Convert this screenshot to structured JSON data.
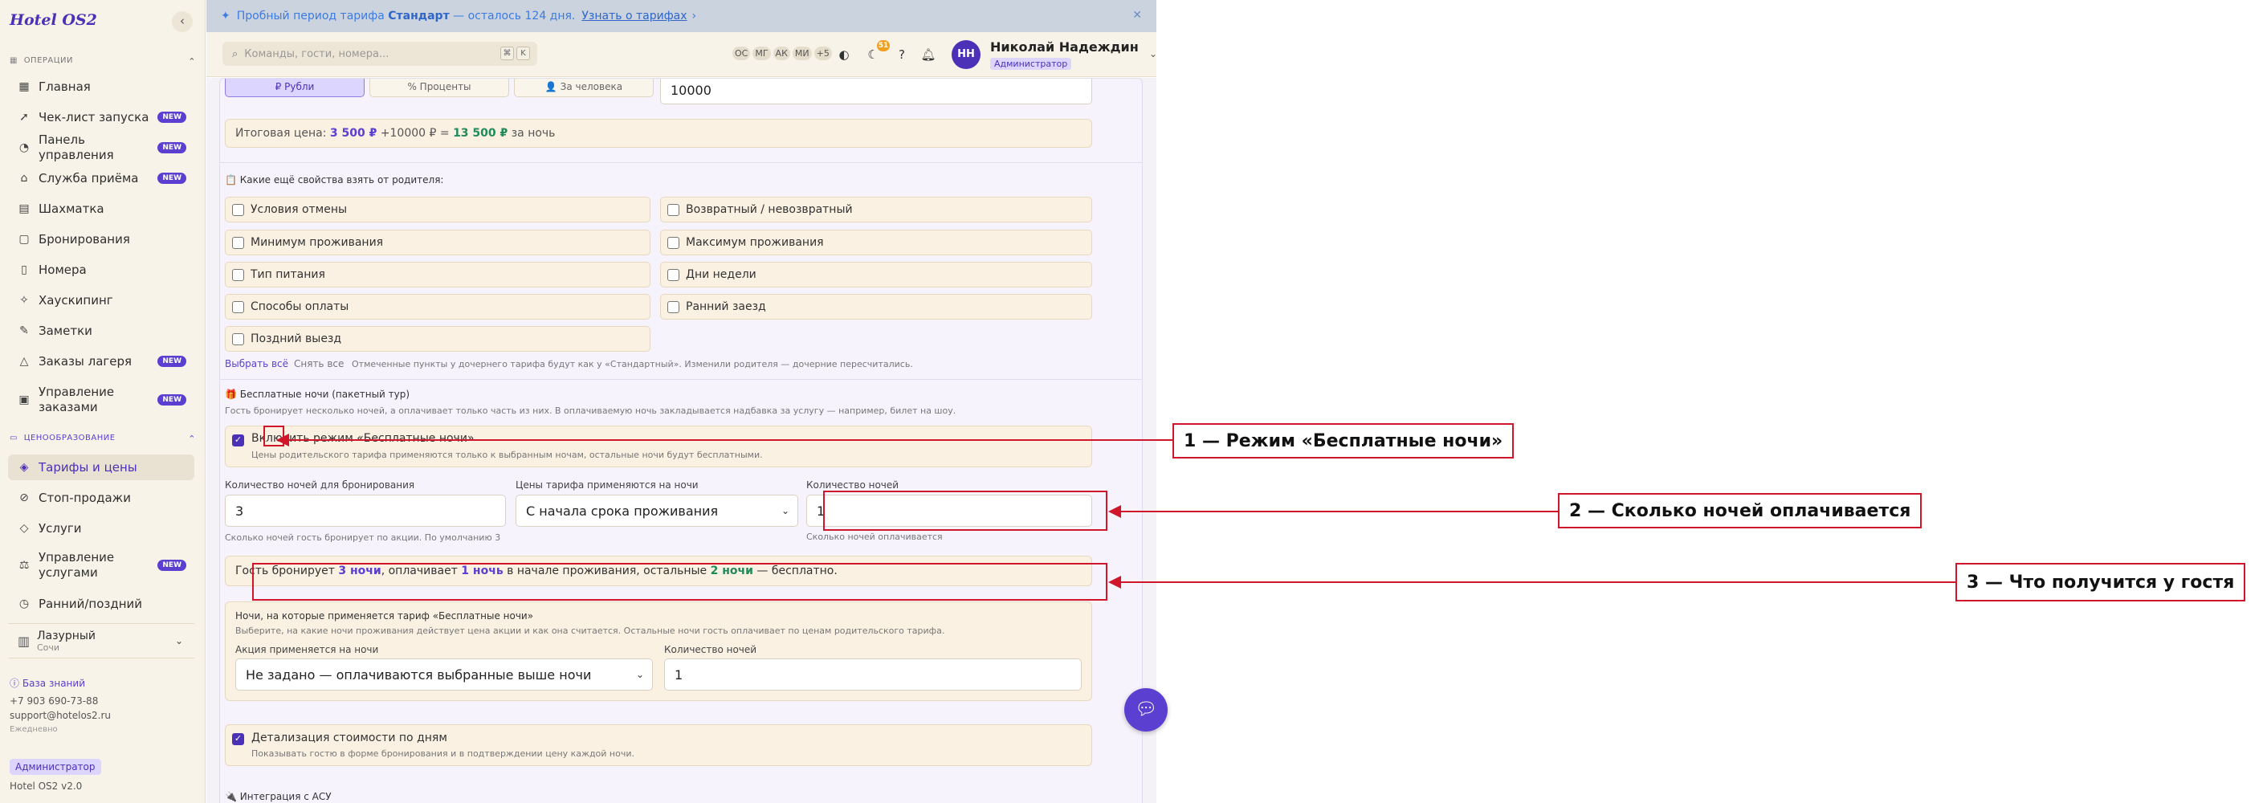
{
  "app": {
    "logo": "Hotel OS2",
    "collapse_icon": "‹"
  },
  "sidebar": {
    "sections": [
      {
        "label": "ОПЕРАЦИИ"
      },
      {
        "label": "ЦЕНООБРАЗОВАНИЕ"
      }
    ],
    "items": [
      {
        "label": "Главная",
        "icon": "grid-icon",
        "glyph": "▦",
        "new": ""
      },
      {
        "label": "Чек-лист запуска",
        "icon": "rocket-icon",
        "glyph": "➚",
        "new": "NEW"
      },
      {
        "label": "Панель управления",
        "icon": "gauge-icon",
        "glyph": "◔",
        "new": "NEW"
      },
      {
        "label": "Служба приёма",
        "icon": "bell-icon",
        "glyph": "⌂",
        "new": "NEW"
      },
      {
        "label": "Шахматка",
        "icon": "table-icon",
        "glyph": "▤",
        "new": ""
      },
      {
        "label": "Бронирования",
        "icon": "calendar-icon",
        "glyph": "▢",
        "new": ""
      },
      {
        "label": "Номера",
        "icon": "door-icon",
        "glyph": "▯",
        "new": ""
      },
      {
        "label": "Хаускипинг",
        "icon": "sparkle-icon",
        "glyph": "✧",
        "new": ""
      },
      {
        "label": "Заметки",
        "icon": "note-icon",
        "glyph": "✎",
        "new": ""
      },
      {
        "label": "Заказы лагеря",
        "icon": "tent-icon",
        "glyph": "△",
        "new": "NEW"
      },
      {
        "label": "Управление заказами",
        "icon": "clipboard-icon",
        "glyph": "▣",
        "new": "NEW"
      },
      {
        "label": "Тарифы и цены",
        "icon": "tag-icon",
        "glyph": "◈",
        "new": ""
      },
      {
        "label": "Стоп-продажи",
        "icon": "ban-icon",
        "glyph": "⊘",
        "new": ""
      },
      {
        "label": "Услуги",
        "icon": "tag-icon",
        "glyph": "◇",
        "new": ""
      },
      {
        "label": "Управление услугами",
        "icon": "service-icon",
        "glyph": "⚖",
        "new": "NEW"
      },
      {
        "label": "Ранний/поздний",
        "icon": "clock-icon",
        "glyph": "◷",
        "new": ""
      }
    ],
    "hotel": {
      "name": "Лазурный",
      "city": "Сочи"
    },
    "kb_link": "База знаний",
    "phone": "+7 903 690-73-88",
    "email": "support@hotelos2.ru",
    "schedule": "Ежедневно",
    "role": "Администратор",
    "version": "Hotel OS2 v2.0"
  },
  "trial": {
    "prefix": "Пробный период тарифа",
    "plan": "Стандарт",
    "suffix": "— осталось 124 дня.",
    "link": "Узнать о тарифах",
    "link_arrow": "›",
    "close": "✕"
  },
  "topbar": {
    "search_placeholder": "Команды, гости, номера...",
    "kbd1": "⌘",
    "kbd2": "K",
    "presence": [
      "ОС",
      "МГ",
      "АК",
      "МИ",
      "+5"
    ],
    "notif_count": "51",
    "user_initials": "НН",
    "user_name": "Николай Надеждин",
    "user_role": "Администратор"
  },
  "form": {
    "price_modes": [
      "₽ Рубли",
      "% Проценты",
      "👤 За человека"
    ],
    "price_value": "10000",
    "total": {
      "label": "Итоговая цена:",
      "base": "3 500 ₽",
      "plus": "+10000 ₽ =",
      "result": "13 500 ₽",
      "suffix": "за ночь"
    },
    "inherit_title": "📋 Какие ещё свойства взять от родителя:",
    "inherit_left": [
      "Условия отмены",
      "Минимум проживания",
      "Тип питания",
      "Способы оплаты",
      "Поздний выезд"
    ],
    "inherit_right": [
      "Возвратный / невозвратный",
      "Максимум проживания",
      "Дни недели",
      "Ранний заезд"
    ],
    "select_all": "Выбрать всё",
    "clear_all": "Снять все",
    "inherit_note": "Отмеченные пункты у дочернего тарифа будут как у «Стандартный». Изменили родителя — дочерние пересчитались.",
    "free_title": "🎁 Бесплатные ночи (пакетный тур)",
    "free_desc": "Гость бронирует несколько ночей, а оплачивает только часть из них. В оплачиваемую ночь закладывается надбавка за услугу — например, билет на шоу.",
    "free_toggle_label": "Включить режим «Бесплатные ночи»",
    "free_toggle_hint": "Цены родительского тарифа применяются только к выбранным ночам, остальные ночи будут бесплатными.",
    "nights_label": "Количество ночей для бронирования",
    "nights_value": "3",
    "nights_hint": "Сколько ночей гость бронирует по акции. По умолчанию 3",
    "apply_label": "Цены тарифа применяются на ночи",
    "apply_value": "С начала срока проживания",
    "paid_label": "Количество ночей",
    "paid_value": "1",
    "paid_hint": "Сколько ночей оплачивается",
    "summary": {
      "p1": "Гость бронирует",
      "v1": "3 ночи",
      "p2": ", оплачивает",
      "v2": "1 ночь",
      "p3": "в начале проживания, остальные",
      "v3": "2 ночи",
      "p4": "— бесплатно."
    },
    "promo_title": "Ночи, на которые применяется тариф «Бесплатные ночи»",
    "promo_desc": "Выберите, на какие ночи проживания действует цена акции и как она считается. Остальные ночи гость оплачивает по ценам родительского тарифа.",
    "promo_apply_label": "Акция применяется на ночи",
    "promo_apply_value": "Не задано — оплачиваются выбранные выше ночи",
    "promo_count_label": "Количество ночей",
    "promo_count_value": "1",
    "detail_label": "Детализация стоимости по дням",
    "detail_hint": "Показывать гостю в форме бронирования и в подтверждении цену каждой ночи.",
    "asu_title": "🔌 Интеграция с АСУ"
  },
  "annotations": [
    "1 — Режим «Бесплатные ночи»",
    "2 — Сколько ночей оплачивается",
    "3 — Что получится у гостя"
  ],
  "colors": {
    "accent": "#5a3fd0",
    "annotation": "#d0162a",
    "sidebar_bg": "#f8f3e8",
    "trial_bg": "#cbd3df"
  }
}
